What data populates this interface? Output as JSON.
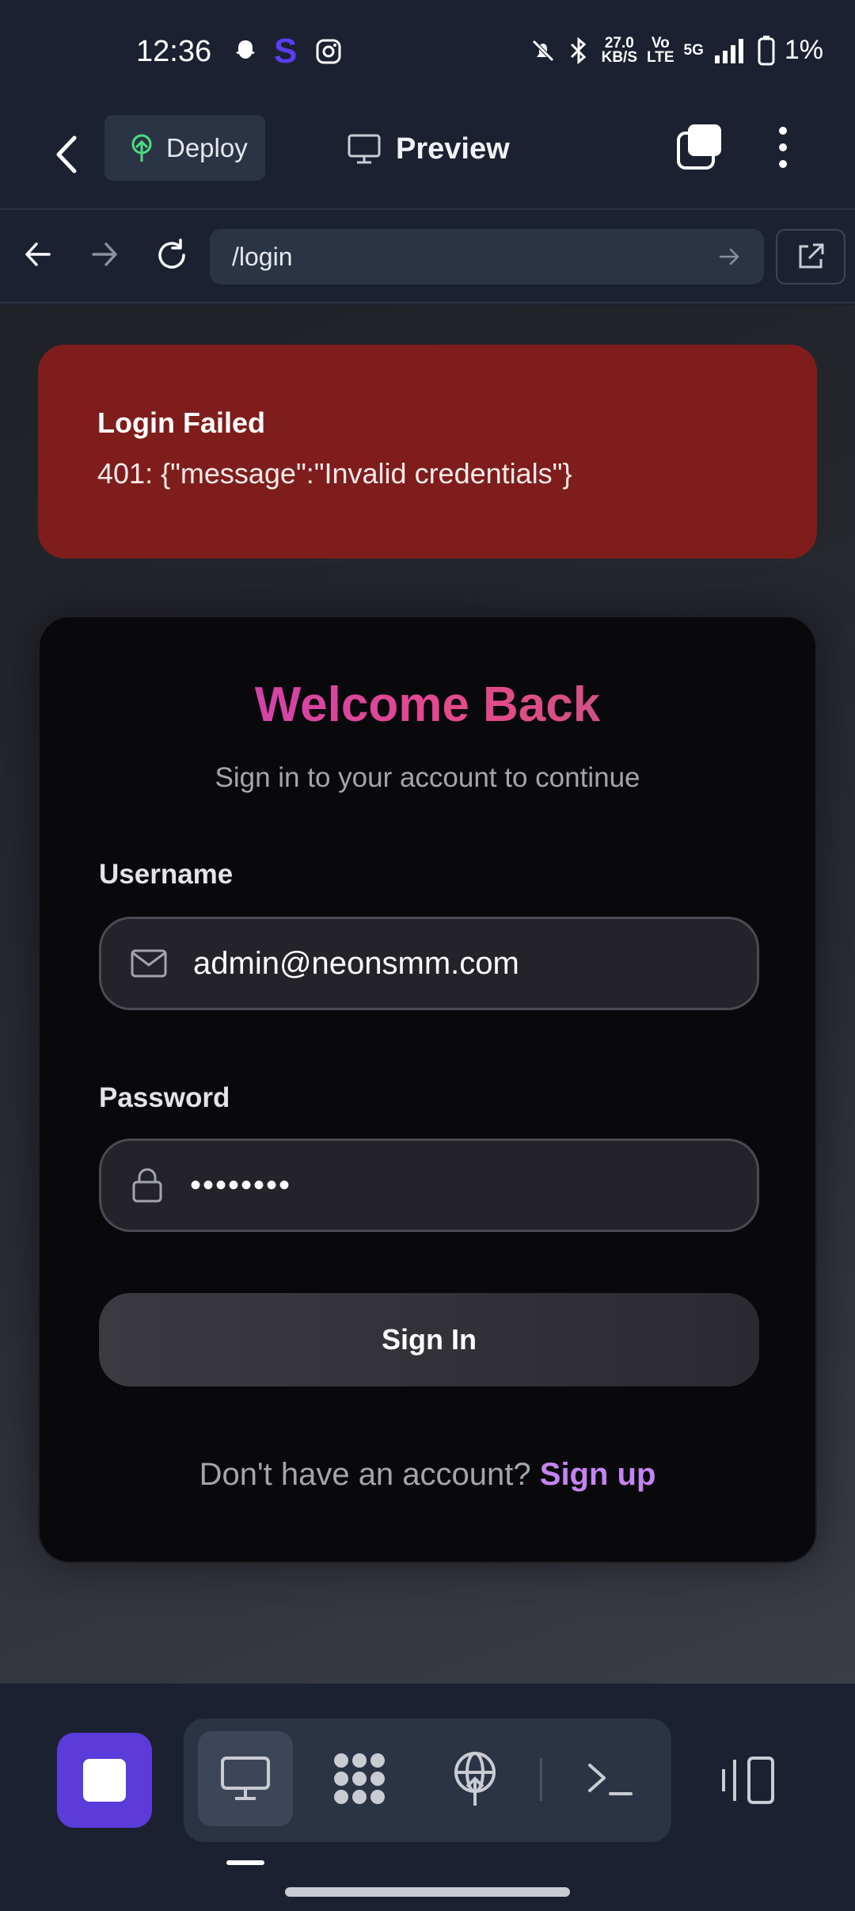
{
  "status_bar": {
    "time": "12:36",
    "app_letter": "S",
    "speed_value": "27.0",
    "speed_unit": "KB/S",
    "volte_top": "Vo",
    "volte_bottom": "LTE",
    "network": "5G",
    "battery": "1%"
  },
  "toolbar": {
    "deploy_label": "Deploy",
    "preview_label": "Preview"
  },
  "url_bar": {
    "url": "/login"
  },
  "toast": {
    "title": "Login Failed",
    "message": "401: {\"message\":\"Invalid credentials\"}"
  },
  "login_card": {
    "title": "Welcome Back",
    "subtitle": "Sign in to your account to continue",
    "username_label": "Username",
    "username_value": "admin@neonsmm.com",
    "password_label": "Password",
    "password_mask": "••••••••",
    "sign_in_label": "Sign In",
    "signup_prompt": "Don't have an account?",
    "signup_link": "Sign up"
  },
  "colors": {
    "accent_purple": "#5b3bd9",
    "error_red": "#7f1d1d",
    "link_purple": "#c584f2"
  }
}
